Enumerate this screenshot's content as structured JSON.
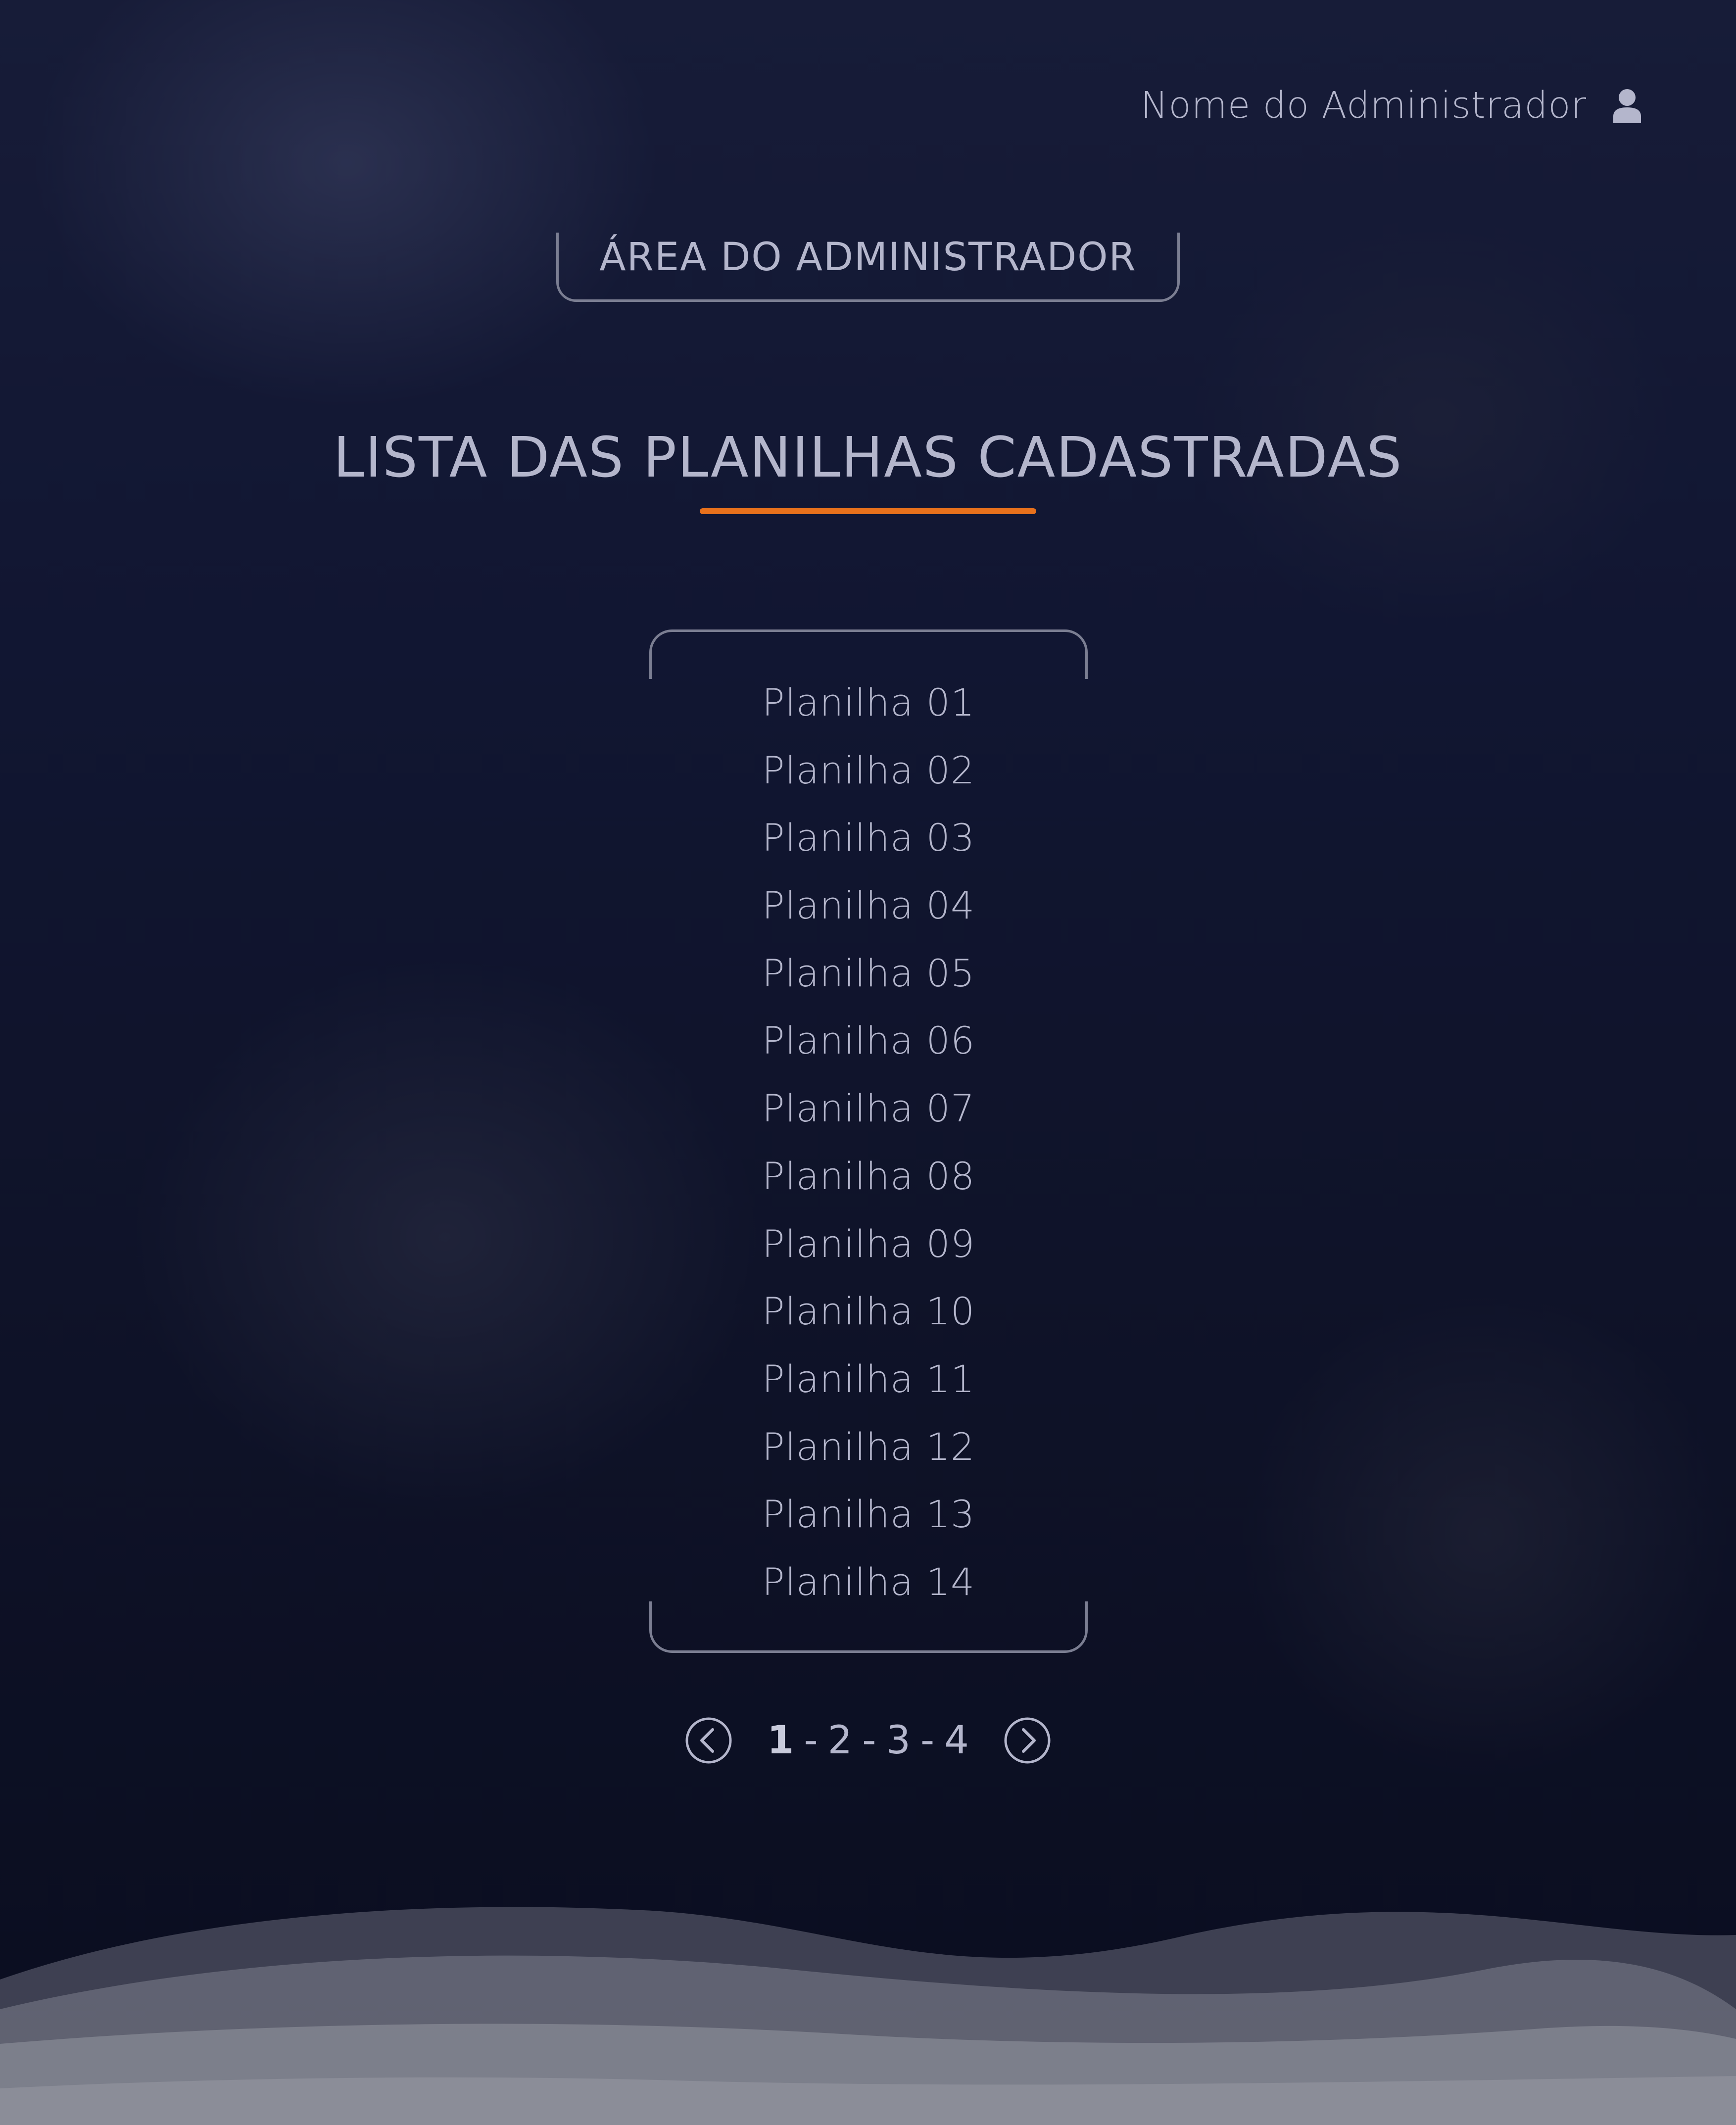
{
  "header": {
    "user_name": "Nome do Administrador",
    "user_icon": "user-icon"
  },
  "admin_area": {
    "label": "ÁREA DO ADMINISTRADOR"
  },
  "page": {
    "title": "LISTA DAS PLANILHAS CADASTRADAS",
    "accent_color": "#e8711c"
  },
  "sheets": [
    "Planilha 01",
    "Planilha 02",
    "Planilha 03",
    "Planilha 04",
    "Planilha 05",
    "Planilha 06",
    "Planilha 07",
    "Planilha 08",
    "Planilha 09",
    "Planilha 10",
    "Planilha 11",
    "Planilha 12",
    "Planilha 13",
    "Planilha 14"
  ],
  "pagination": {
    "pages": [
      "1",
      "2",
      "3",
      "4"
    ],
    "current": "1",
    "separator": "-",
    "prev_icon": "chevron-left-icon",
    "next_icon": "chevron-right-icon"
  }
}
